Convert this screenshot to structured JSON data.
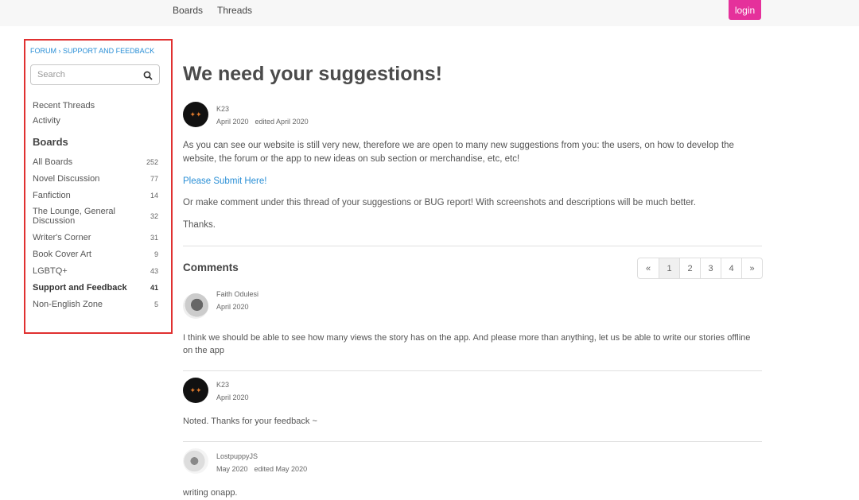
{
  "topnav": {
    "boards": "Boards",
    "threads": "Threads",
    "login": "login"
  },
  "sidebar": {
    "breadcrumb": "FORUM › SUPPORT AND FEEDBACK",
    "search_placeholder": "Search",
    "links": [
      "Recent Threads",
      "Activity"
    ],
    "boards_heading": "Boards",
    "boards": [
      {
        "label": "All Boards",
        "count": "252"
      },
      {
        "label": "Novel Discussion",
        "count": "77"
      },
      {
        "label": "Fanfiction",
        "count": "14"
      },
      {
        "label": "The Lounge, General Discussion",
        "count": "32"
      },
      {
        "label": "Writer's Corner",
        "count": "31"
      },
      {
        "label": "Book Cover Art",
        "count": "9"
      },
      {
        "label": "LGBTQ+",
        "count": "43"
      },
      {
        "label": "Support and Feedback",
        "count": "41",
        "active": true
      },
      {
        "label": "Non-English Zone",
        "count": "5"
      }
    ]
  },
  "post": {
    "title": "We need your suggestions!",
    "author": "K23",
    "date": "April 2020",
    "edited": "edited April 2020",
    "body1": "As you can see our website is still very new, therefore we are open to many new suggestions from you: the users, on how to develop the website, the forum or the app to new ideas on sub section or merchandise, etc, etc!",
    "submit_link": "Please Submit Here!",
    "body2": "Or make comment under this thread of your suggestions or BUG report! With screenshots and descriptions will be much better.",
    "body3": "Thanks."
  },
  "comments": {
    "heading": "Comments",
    "pager": [
      "«",
      "1",
      "2",
      "3",
      "4",
      "»"
    ],
    "items": [
      {
        "author": "Faith Odulesi",
        "date": "April 2020",
        "edited": "",
        "text": "I think we should be able to see how many views the story has on the app. And please more than anything, let us be able to write our stories offline on the app"
      },
      {
        "author": "K23",
        "date": "April 2020",
        "edited": "",
        "text": "Noted. Thanks for your feedback ~"
      },
      {
        "author": "LostpuppyJS",
        "date": "May 2020",
        "edited": "edited May 2020",
        "text": "writing onapp."
      }
    ]
  },
  "colors": {
    "accent": "#e5319b",
    "link": "#2a8fd6",
    "highlight_border": "#e03030"
  }
}
